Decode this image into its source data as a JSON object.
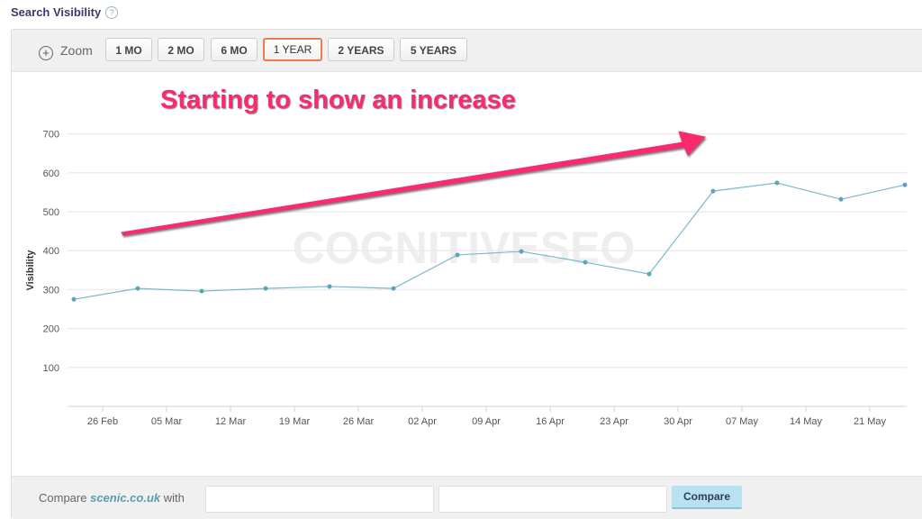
{
  "header": {
    "title": "Search Visibility",
    "help_icon": "question-icon"
  },
  "toolbar": {
    "zoom_label": "Zoom",
    "zoom_icon": "zoom-in-icon",
    "buttons": [
      "1 MO",
      "2 MO",
      "6 MO",
      "1 YEAR",
      "2 YEARS",
      "5 YEARS"
    ],
    "active": "1 YEAR"
  },
  "annotation": {
    "text": "Starting to show an increase",
    "color": "#fb2a6c"
  },
  "watermark": "COGNITIVESEO",
  "chart_data": {
    "type": "line",
    "ylabel": "Visibility",
    "xlabel": "",
    "ylim": [
      0,
      700
    ],
    "yticks": [
      100,
      200,
      300,
      400,
      500,
      600,
      700
    ],
    "xticks": [
      "26 Feb",
      "05 Mar",
      "12 Mar",
      "19 Mar",
      "26 Mar",
      "02 Apr",
      "09 Apr",
      "16 Apr",
      "23 Apr",
      "30 Apr",
      "07 May",
      "14 May",
      "21 May"
    ],
    "x": [
      "23 Feb",
      "02 Mar",
      "09 Mar",
      "16 Mar",
      "23 Mar",
      "30 Mar",
      "06 Apr",
      "13 Apr",
      "20 Apr",
      "27 Apr",
      "04 May",
      "11 May",
      "18 May",
      "25 May"
    ],
    "values": [
      275,
      303,
      296,
      303,
      308,
      303,
      389,
      398,
      370,
      340,
      553,
      574,
      532,
      569
    ],
    "grid": true,
    "line_color": "#7bb8cc"
  },
  "footer": {
    "compare_prefix": "Compare",
    "domain": "scenic.co.uk",
    "compare_suffix": "with",
    "compare_button": "Compare",
    "input1": "",
    "input2": ""
  }
}
